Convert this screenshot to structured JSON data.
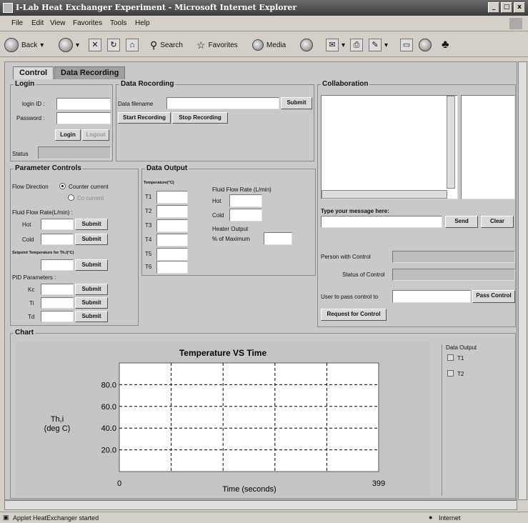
{
  "window": {
    "title": "I-Lab Heat Exchanger Experiment - Microsoft Internet Explorer",
    "min": "_",
    "max": "□",
    "close": "x"
  },
  "menu": {
    "file": "File",
    "edit": "Edit",
    "view": "View",
    "favorites": "Favorites",
    "tools": "Tools",
    "help": "Help"
  },
  "toolbar": {
    "back": "Back",
    "search": "Search",
    "favorites": "Favorites",
    "media": "Media"
  },
  "tabs": {
    "control": "Control",
    "recording": "Data Recording"
  },
  "login": {
    "title": "Login",
    "login_id_label": "login ID :",
    "password_label": "Password :",
    "login_button": "Login",
    "logout_button": "Logout",
    "status_label": "Status"
  },
  "data_recording": {
    "title": "Data Rocording",
    "filename_label": "Data filename",
    "submit": "Submit",
    "start": "Start Recording",
    "stop": "Stop Recording"
  },
  "collaboration": {
    "title": "Collaboration",
    "type_label": "Type your message here:",
    "send": "Send",
    "clear": "Clear",
    "person_label": "Person with Control",
    "status_label": "Status of Control",
    "pass_label": "User to pass control to",
    "pass_button": "Pass Control",
    "request_button": "Request for Control"
  },
  "parameters": {
    "title": "Parameter Controls",
    "flow_direction": "Flow Direction",
    "counter": "Counter current",
    "co": "Co current",
    "fluid_rate": "Fluid Flow Rate(L/min) :",
    "hot": "Hot",
    "cold": "Cold",
    "setpoint": "Setpoint Temperature for Th,i(°C)",
    "pid": "PID Parameters :",
    "kc": "Kc",
    "ti": "Ti",
    "td": "Td",
    "submit": "Submit"
  },
  "data_output": {
    "title": "Data Output",
    "temp_header": "Temperature(°C)",
    "t_labels": [
      "T1",
      "T2",
      "T3",
      "T4",
      "T5",
      "T6"
    ],
    "flow_header": "Fluid Flow Rate (L/min)",
    "hot": "Hot",
    "cold": "Cold",
    "heater": "Heater Output",
    "pct_max": "% of Maximum"
  },
  "chart_section": {
    "title": "Chart",
    "legend_title": "Data Output",
    "legend_items": [
      "T1",
      "T2"
    ]
  },
  "chart_data": {
    "type": "line",
    "title": "Temperature VS Time",
    "xlabel": "Time (seconds)",
    "ylabel": "Th,i\n(deg C)",
    "xlim": [
      0,
      399
    ],
    "x_ticks": [
      "0",
      "399"
    ],
    "ylim": [
      0,
      100
    ],
    "y_ticks": [
      "20.0",
      "40.0",
      "60.0",
      "80.0"
    ],
    "grid": true,
    "series": []
  },
  "statusbar": {
    "text": "Applet HeatExchanger started",
    "zone": "Internet"
  }
}
